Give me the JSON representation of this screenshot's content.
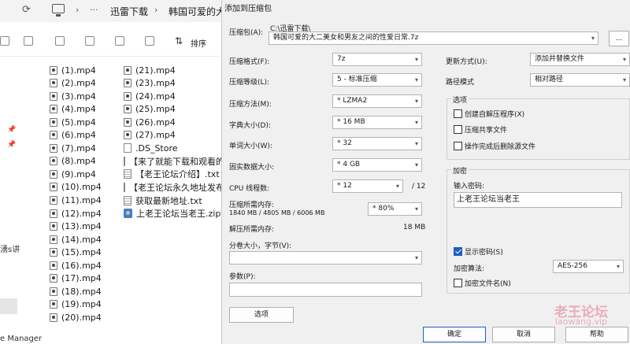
{
  "explorer": {
    "breadcrumb_sep": "›",
    "breadcrumb": [
      "迅雷下载",
      "韩国可爱的大"
    ],
    "ellipsis": "···",
    "sort_label": "排序",
    "sidebar_snippet": "湧s讲",
    "bottom_snippet": "e Manager",
    "files_col1": [
      "(1).mp4",
      "(2).mp4",
      "(3).mp4",
      "(4).mp4",
      "(5).mp4",
      "(6).mp4",
      "(7).mp4",
      "(8).mp4",
      "(9).mp4",
      "(10).mp4",
      "(11).mp4",
      "(12).mp4",
      "(13).mp4",
      "(14).mp4",
      "(15).mp4",
      "(16).mp4",
      "(17).mp4",
      "(18).mp4",
      "(19).mp4",
      "(20).mp4"
    ],
    "files_col2": [
      {
        "name": "(21).mp4",
        "icon": "video-file-icon"
      },
      {
        "name": "(23).mp4",
        "icon": "video-file-icon"
      },
      {
        "name": "(24).mp4",
        "icon": "video-file-icon"
      },
      {
        "name": "(25).mp4",
        "icon": "video-file-icon"
      },
      {
        "name": "(26).mp4",
        "icon": "video-file-icon"
      },
      {
        "name": "(27).mp4",
        "icon": "video-file-icon"
      },
      {
        "name": ".DS_Store",
        "icon": "blank-file-icon"
      },
      {
        "name": "【来了就能下载和观看的论",
        "icon": "text-file-icon"
      },
      {
        "name": "【老王论坛介绍】.txt",
        "icon": "text-file-icon"
      },
      {
        "name": "【老王论坛永久地址发布页",
        "icon": "text-file-icon"
      },
      {
        "name": "获取最新地址.txt",
        "icon": "text-file-icon"
      },
      {
        "name": "上老王论坛当老王.zip",
        "icon": "zip-file-icon"
      }
    ]
  },
  "dialog": {
    "title": "添加到压缩包",
    "archive_label": "压缩包(A):",
    "archive_path": "C:\\迅雷下载\\",
    "archive_name": "韩国可爱的大二美女和男友之间的性爱日常.7z",
    "browse_label": "...",
    "format_label": "压缩格式(F):",
    "format_value": "7z",
    "level_label": "压缩等级(L):",
    "level_value": "5 - 标准压缩",
    "method_label": "压缩方法(M):",
    "method_value": "* LZMA2",
    "dict_label": "字典大小(D):",
    "dict_value": "* 16 MB",
    "word_label": "单词大小(W):",
    "word_value": "* 32",
    "solid_label": "固实数据大小:",
    "solid_value": "* 4 GB",
    "cpu_label": "CPU 线程数:",
    "cpu_value": "* 12",
    "cpu_max": "/ 12",
    "mem_compress_label": "压缩所需内存:",
    "mem_compress_detail": "1840 MB / 4805 MB / 6006 MB",
    "mem_compress_value": "* 80%",
    "mem_decompress_label": "解压所需内存:",
    "mem_decompress_value": "18 MB",
    "split_label": "分卷大小，字节(V):",
    "params_label": "参数(P):",
    "options_button": "选项",
    "update_label": "更新方式(U):",
    "update_value": "添加并替换文件",
    "path_label": "路径模式",
    "path_value": "相对路径",
    "options_group": "选项",
    "opt_sfx": "创建自解压程序(X)",
    "opt_shared": "压缩共享文件",
    "opt_delete": "操作完成后删除源文件",
    "encrypt_group": "加密",
    "password_label": "输入密码:",
    "password_value": "上老王论坛当老王",
    "show_password": "显示密码(S)",
    "encrypt_method_label": "加密算法:",
    "encrypt_method_value": "AES-256",
    "encrypt_names": "加密文件名(N)",
    "ok_button": "确定",
    "cancel_button": "取消",
    "help_button": "帮助"
  },
  "watermark": {
    "text": "老王论坛",
    "sub": "laowang.vip"
  }
}
